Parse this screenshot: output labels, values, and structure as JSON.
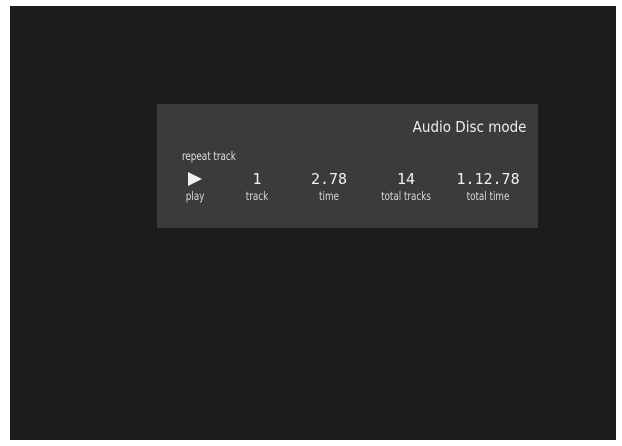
{
  "osd": {
    "mode_title": "Audio Disc mode",
    "repeat_label": "repeat track",
    "play": {
      "icon": "play-icon",
      "label": "play"
    },
    "track": {
      "value": "1",
      "label": "track"
    },
    "time": {
      "value": "2.78",
      "label": "time"
    },
    "total_tracks": {
      "value": "14",
      "label": "total tracks"
    },
    "total_time": {
      "value": "1.12.78",
      "label": "total time"
    }
  },
  "colors": {
    "screen_background": "#1c1c1c",
    "panel_background": "#3b3b3b",
    "text": "#e6e6e6"
  }
}
